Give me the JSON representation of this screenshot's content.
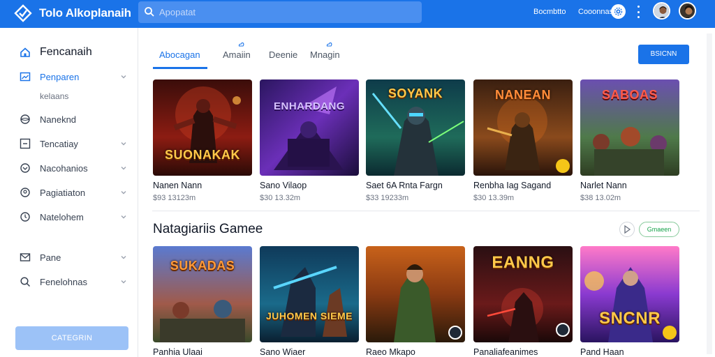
{
  "header": {
    "title": "Tolo Alkoplanaih",
    "search_placeholder": "Apopatat",
    "link_1": "Bocmbtto",
    "link_2": "Cooonnas",
    "brand_color": "#1a73e8"
  },
  "sidebar": {
    "heading": "Fencanaih",
    "items": [
      {
        "label": "Penparen",
        "icon": "image-icon",
        "active": true
      },
      {
        "label": "Naneknd",
        "icon": "globe-icon"
      },
      {
        "label": "Tencatiay",
        "icon": "minus-square-icon"
      },
      {
        "label": "Nacohanios",
        "icon": "shield-icon"
      },
      {
        "label": "Pagiatiaton",
        "icon": "badge-icon"
      },
      {
        "label": "Natelohem",
        "icon": "clock-icon"
      },
      {
        "label": "Pane",
        "icon": "mail-icon"
      },
      {
        "label": "Fenelohnas",
        "icon": "search-icon"
      }
    ],
    "sub_label": "kelaans",
    "cta_label": "CATEGRIN"
  },
  "tabs": [
    {
      "label": "Abocagan",
      "active": true
    },
    {
      "label": "Amaiin"
    },
    {
      "label": "Deenie"
    },
    {
      "label": "Mnagin"
    }
  ],
  "primary_button": "BSICNN",
  "row1": [
    {
      "thumb_title": "SUONAKAK",
      "title": "Nanen Nann",
      "meta": "$93 13123m"
    },
    {
      "thumb_title": "ENHARDANG",
      "title": "Sano Vilaop",
      "meta": "$30 13.32m"
    },
    {
      "thumb_title": "SOYANK",
      "title": "Saet 6A Rnta Fargn",
      "meta": "$33 19233m"
    },
    {
      "thumb_title": "NANEAN",
      "title": "Renbha Iag Sagand",
      "meta": "$30 13.39m"
    },
    {
      "thumb_title": "SABOAS",
      "title": "Narlet Nann",
      "meta": "$38 13.02m"
    }
  ],
  "section": {
    "title": "Natagiariis Gamee",
    "pill_label": "Gmaeen"
  },
  "row2": [
    {
      "thumb_title": "SUKADAS",
      "title": "Panhia Ulaai"
    },
    {
      "thumb_title": "JUHOMEN SIEME",
      "title": "Sano Wiaer"
    },
    {
      "thumb_title": "",
      "title": "Raeo Mkapo"
    },
    {
      "thumb_title": "EANNG",
      "title": "Panaliafeanimes"
    },
    {
      "thumb_title": "SNCNR",
      "title": "Pand Haan"
    }
  ]
}
